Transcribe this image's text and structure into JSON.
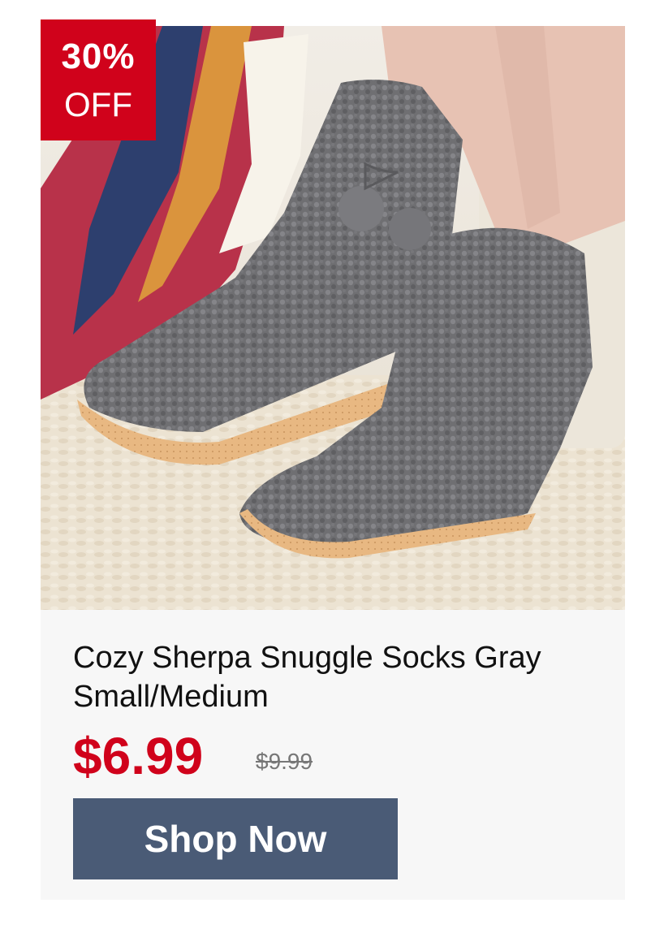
{
  "product": {
    "discount_percent": "30%",
    "discount_label": "OFF",
    "title": "Cozy Sherpa Snuggle Socks Gray Small/Medium",
    "price": "$6.99",
    "original_price": "$9.99",
    "cta_label": "Shop Now"
  },
  "colors": {
    "badge": "#d0021b",
    "price": "#d0021b",
    "button": "#4a5b76"
  }
}
